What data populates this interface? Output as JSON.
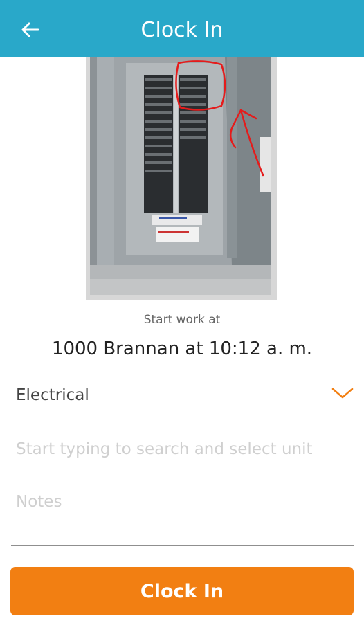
{
  "header": {
    "title": "Clock In",
    "back_icon": "arrow-left-icon",
    "background_color": "#29a8c9"
  },
  "photo": {
    "description_icon": "electrical-panel-photo"
  },
  "work": {
    "start_label": "Start work at",
    "location_line": "1000 Brannan at 10:12 a. m."
  },
  "form": {
    "category_value": "Electrical",
    "category_icon": "chevron-down-icon",
    "unit_placeholder": "Start typing to search and select unit",
    "notes_placeholder": "Notes"
  },
  "actions": {
    "clock_in_label": "Clock In",
    "button_color": "#f27f12"
  }
}
